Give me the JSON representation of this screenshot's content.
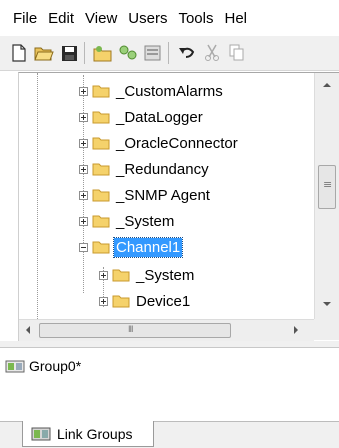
{
  "menu": [
    "File",
    "Edit",
    "View",
    "Users",
    "Tools",
    "Hel"
  ],
  "toolbar": {
    "icons": [
      "new-icon",
      "open-icon",
      "save-icon",
      "new-channel-icon",
      "new-device-icon",
      "properties-icon",
      "undo-icon",
      "cut-icon",
      "copy-icon"
    ]
  },
  "tree": {
    "items": [
      {
        "label": "_CustomAlarms"
      },
      {
        "label": "_DataLogger"
      },
      {
        "label": "_OracleConnector"
      },
      {
        "label": "_Redundancy"
      },
      {
        "label": "_SNMP Agent"
      },
      {
        "label": "_System"
      },
      {
        "label": "Channel1",
        "selected": true,
        "expanded": true
      },
      {
        "label": "_System"
      },
      {
        "label": "Device1"
      }
    ]
  },
  "groups": {
    "item": "Group0*"
  },
  "tabs": {
    "link_groups": "Link Groups"
  },
  "colors": {
    "selection": "#3399ff",
    "folder": "#f5d26b",
    "folder_dark": "#c99a2e"
  }
}
